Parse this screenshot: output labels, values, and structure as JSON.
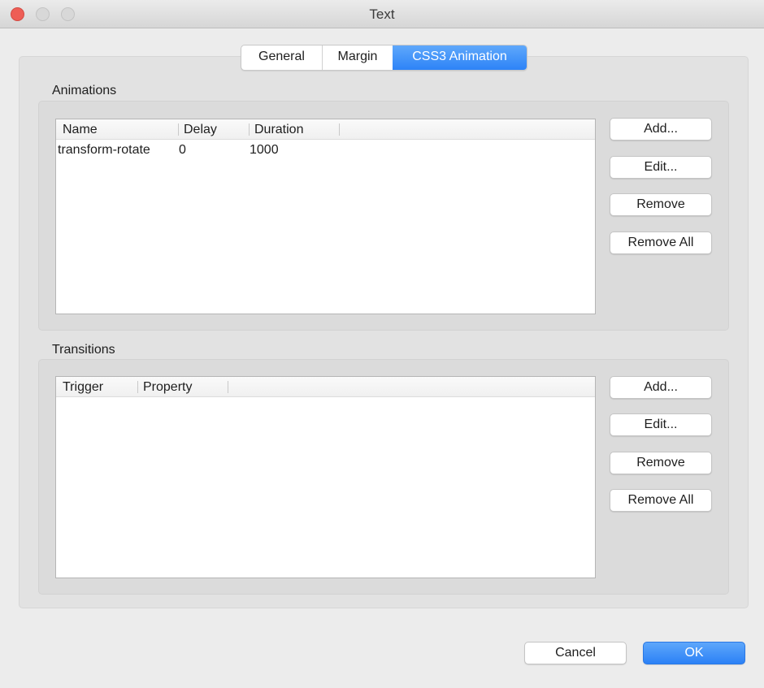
{
  "window": {
    "title": "Text"
  },
  "tabs": [
    {
      "label": "General",
      "selected": false
    },
    {
      "label": "Margin",
      "selected": false
    },
    {
      "label": "CSS3 Animation",
      "selected": true
    }
  ],
  "animations": {
    "label": "Animations",
    "columns": [
      "Name",
      "Delay",
      "Duration"
    ],
    "rows": [
      {
        "name": "transform-rotate",
        "delay": "0",
        "duration": "1000"
      }
    ],
    "buttons": {
      "add": "Add...",
      "edit": "Edit...",
      "remove": "Remove",
      "remove_all": "Remove All"
    }
  },
  "transitions": {
    "label": "Transitions",
    "columns": [
      "Trigger",
      "Property"
    ],
    "rows": [],
    "buttons": {
      "add": "Add...",
      "edit": "Edit...",
      "remove": "Remove",
      "remove_all": "Remove All"
    }
  },
  "footer": {
    "cancel": "Cancel",
    "ok": "OK"
  },
  "colors": {
    "accent": "#2d83f7",
    "close_button": "#ee5e56"
  }
}
